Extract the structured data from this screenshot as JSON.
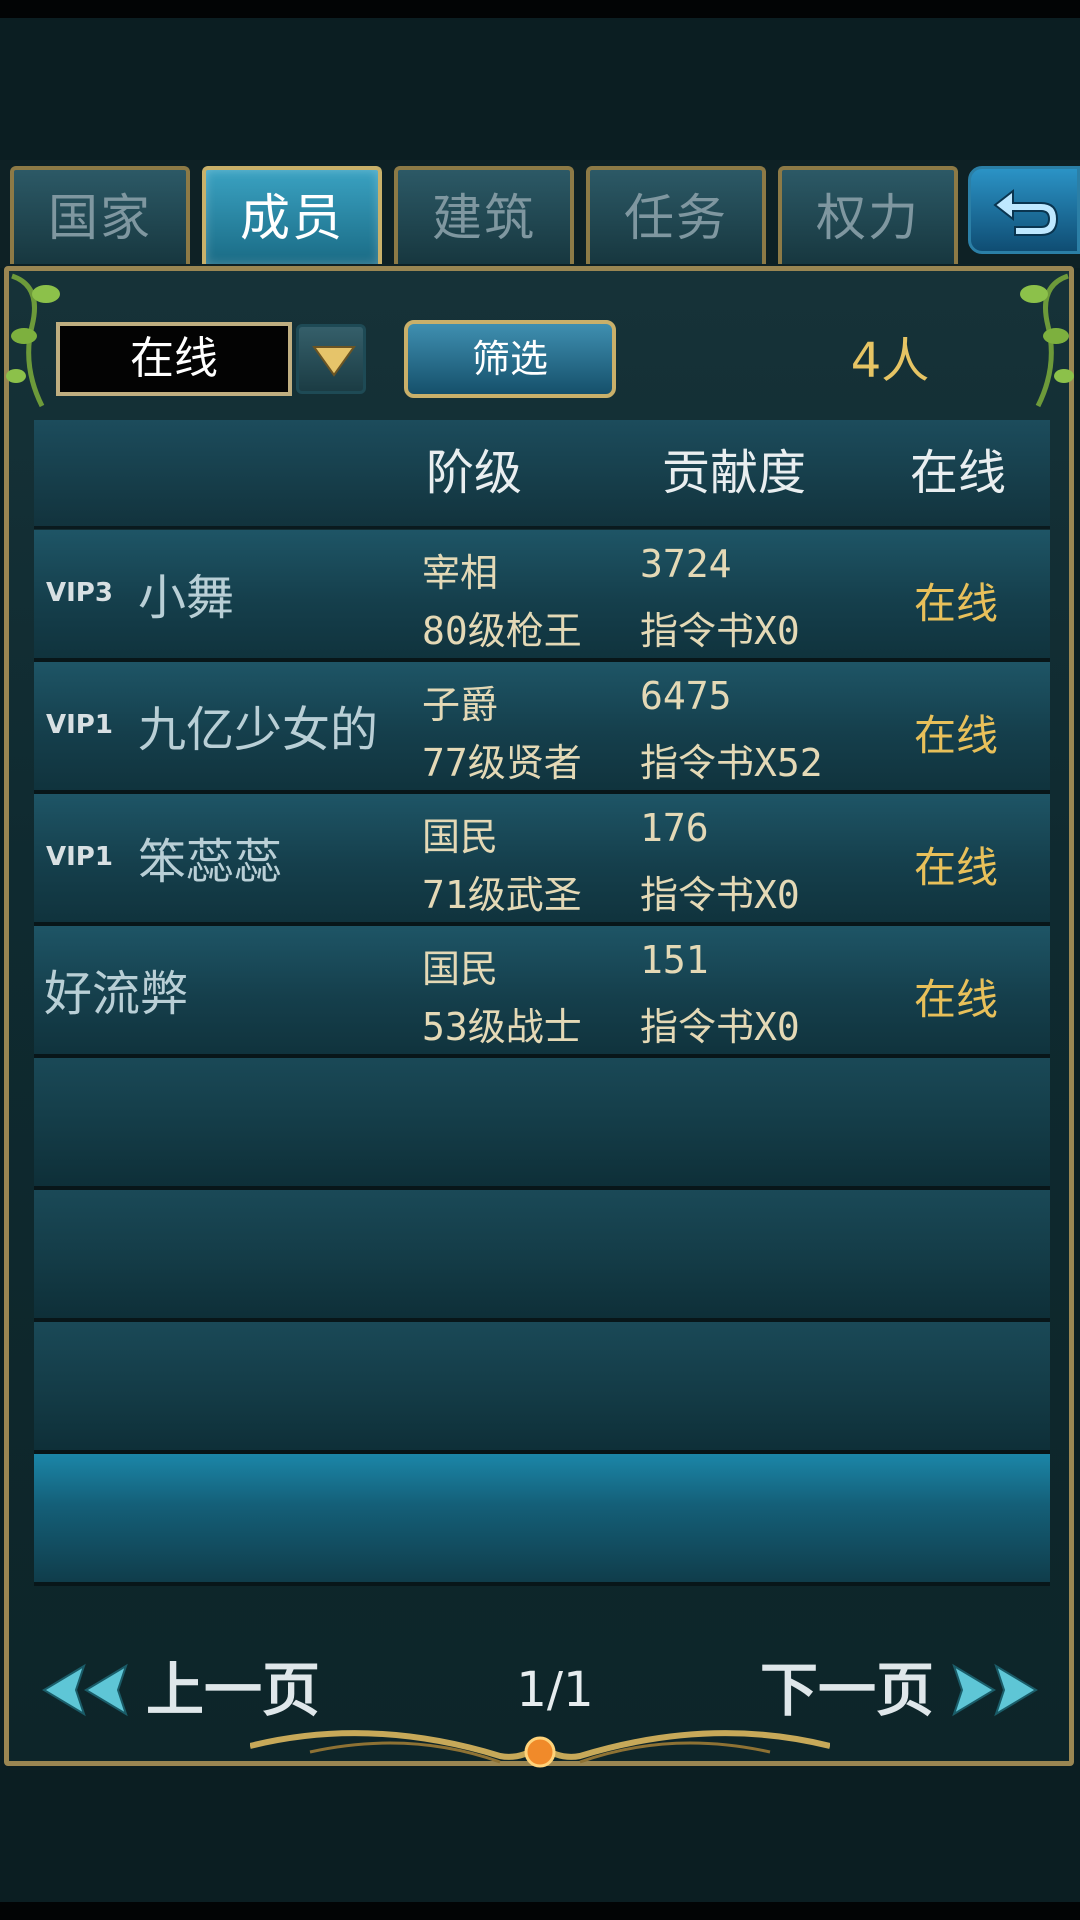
{
  "tabs": [
    {
      "label": "国家",
      "active": false
    },
    {
      "label": "成员",
      "active": true
    },
    {
      "label": "建筑",
      "active": false
    },
    {
      "label": "任务",
      "active": false
    },
    {
      "label": "权力",
      "active": false
    }
  ],
  "back_icon": "return-arrow-icon",
  "filter": {
    "dropdown_value": "在线",
    "button_label": "筛选",
    "count": "4人"
  },
  "table": {
    "headers": {
      "rank": "阶级",
      "contribution": "贡献度",
      "online": "在线"
    },
    "rows": [
      {
        "vip": "VIP3",
        "name": "小舞",
        "rank": "宰相",
        "class": "80级枪王",
        "contribution": "3724",
        "items": "指令书X0",
        "status": "在线"
      },
      {
        "vip": "VIP1",
        "name": "九亿少女的",
        "rank": "子爵",
        "class": "77级贤者",
        "contribution": "6475",
        "items": "指令书X52",
        "status": "在线"
      },
      {
        "vip": "VIP1",
        "name": "笨蕊蕊",
        "rank": "国民",
        "class": "71级武圣",
        "contribution": "176",
        "items": "指令书X0",
        "status": "在线"
      },
      {
        "vip": "",
        "name": "好流弊",
        "rank": "国民",
        "class": "53级战士",
        "contribution": "151",
        "items": "指令书X0",
        "status": "在线"
      }
    ]
  },
  "pager": {
    "prev_label": "上一页",
    "next_label": "下一页",
    "page": "1/1"
  },
  "colors": {
    "gold": "#e8c05a",
    "frame": "#9a8652",
    "tab_active": "#3aa2c2"
  }
}
